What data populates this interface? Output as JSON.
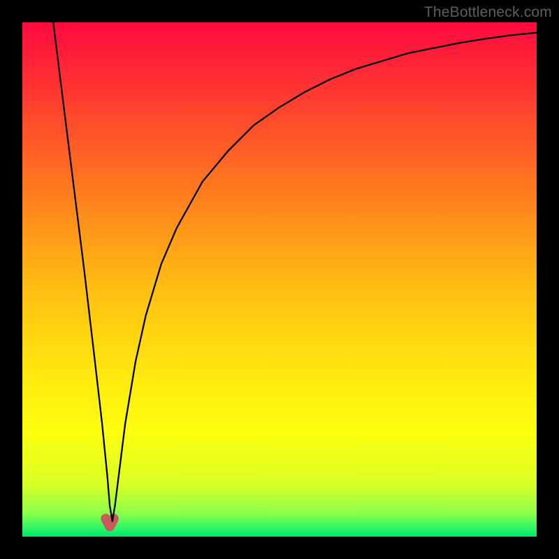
{
  "watermark": "TheBottleneck.com",
  "chart_data": {
    "type": "line",
    "title": "",
    "xlabel": "",
    "ylabel": "",
    "xlim": [
      0,
      100
    ],
    "ylim": [
      0,
      100
    ],
    "grid": false,
    "series": [
      {
        "name": "bottleneck-curve",
        "x": [
          6,
          8,
          10,
          12,
          14,
          15.5,
          16.5,
          17,
          17.5,
          18,
          19,
          20,
          22,
          24,
          27,
          30,
          35,
          40,
          45,
          50,
          55,
          60,
          65,
          70,
          75,
          80,
          85,
          90,
          95,
          100
        ],
        "values": [
          100,
          84,
          68,
          52,
          35,
          22,
          12,
          6,
          3,
          6,
          14,
          22,
          34,
          43,
          53,
          60,
          69,
          75,
          80,
          83.5,
          86.5,
          89,
          91,
          92.5,
          94,
          95,
          96,
          96.8,
          97.5,
          98
        ]
      }
    ],
    "markers": [
      {
        "name": "cusp-left",
        "x": 16.2,
        "y": 3.5
      },
      {
        "name": "cusp-bottom",
        "x": 17.0,
        "y": 2.0
      },
      {
        "name": "cusp-right",
        "x": 17.8,
        "y": 3.5
      }
    ],
    "background_gradient_stops": [
      {
        "offset": 0.0,
        "color": "#ff0a3f"
      },
      {
        "offset": 0.1,
        "color": "#ff2b35"
      },
      {
        "offset": 0.28,
        "color": "#ff6a22"
      },
      {
        "offset": 0.5,
        "color": "#ffb912"
      },
      {
        "offset": 0.68,
        "color": "#ffe70e"
      },
      {
        "offset": 0.8,
        "color": "#fdff0f"
      },
      {
        "offset": 0.9,
        "color": "#d8ff26"
      },
      {
        "offset": 0.955,
        "color": "#89ff4a"
      },
      {
        "offset": 0.985,
        "color": "#29f56a"
      },
      {
        "offset": 1.0,
        "color": "#00e76b"
      }
    ],
    "marker_style": {
      "stroke": "#c85b5b",
      "stroke_width": 14,
      "linecap": "round"
    },
    "curve_style": {
      "stroke": "#000000",
      "stroke_width": 2.3
    }
  }
}
